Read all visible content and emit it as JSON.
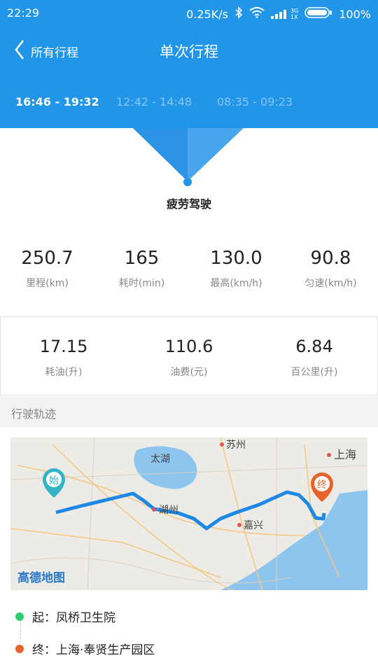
{
  "status": {
    "time": "22:29",
    "net_speed": "0.25K/s",
    "signal_3g": "3G",
    "signal_1x": "1X",
    "battery": "100%"
  },
  "nav": {
    "back_label": "所有行程",
    "title": "单次行程"
  },
  "trips": [
    {
      "label": "16:46 - 19:32"
    },
    {
      "label": "12:42 - 14:48"
    },
    {
      "label": "08:35 - 09:23"
    }
  ],
  "event_label": "疲劳驾驶",
  "stats": [
    {
      "value": "250.7",
      "label": "里程(km)"
    },
    {
      "value": "165",
      "label": "耗时(min)"
    },
    {
      "value": "130.0",
      "label": "最高(km/h)"
    },
    {
      "value": "90.8",
      "label": "匀速(km/h)"
    }
  ],
  "fuel": [
    {
      "value": "17.15",
      "label": "耗油(升)"
    },
    {
      "value": "110.6",
      "label": "油费(元)"
    },
    {
      "value": "6.84",
      "label": "百公里(升)"
    }
  ],
  "section_title": "行驶轨迹",
  "map": {
    "start_marker": "始",
    "end_marker": "终",
    "lake_label": "太湖",
    "city_suzhou": "苏州",
    "city_shanghai": "上海",
    "city_huzhou": "湖州",
    "city_jiaxing": "嘉兴",
    "watermark": "高德地图"
  },
  "route": {
    "start": "起：凤桥卫生院",
    "end": "终：上海·奉贤生产园区"
  },
  "colors": {
    "header_blue": "#2196e8",
    "route_blue": "#1e88e5",
    "start_teal": "#35b3c6",
    "end_orange": "#e8622c",
    "start_dot": "#2ecc71",
    "end_dot": "#e8622c"
  }
}
